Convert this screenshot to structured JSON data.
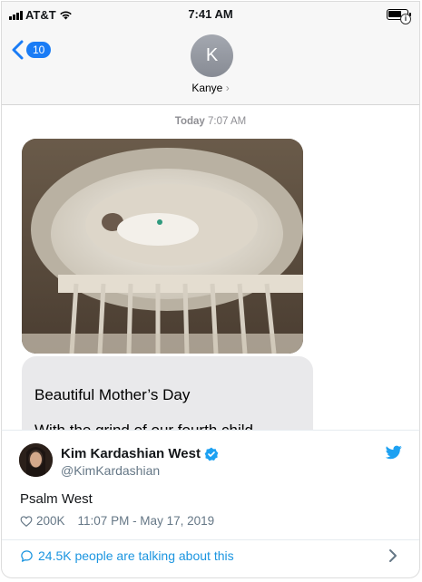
{
  "status_bar": {
    "carrier": "AT&T",
    "time": "7:41 AM",
    "icons": [
      "signal-icon",
      "wifi-icon",
      "battery-icon"
    ]
  },
  "imessage": {
    "back_count": "10",
    "contact_initial": "K",
    "contact_name": "Kanye",
    "timestamp_day": "Today",
    "timestamp_time": "7:07 AM",
    "message_line1": "Beautiful Mother’s Day",
    "message_line2": "With the grind of our fourth child"
  },
  "tweet": {
    "display_name": "Kim Kardashian West",
    "handle": "@KimKardashian",
    "text": "Psalm West",
    "likes": "200K",
    "datetime": "11:07 PM - May 17, 2019",
    "talking": "24.5K people are talking about this"
  },
  "colors": {
    "imessage_blue": "#1a7cf5",
    "twitter_blue": "#1da1f2",
    "link_blue": "#1b95e0",
    "muted": "#657786"
  }
}
